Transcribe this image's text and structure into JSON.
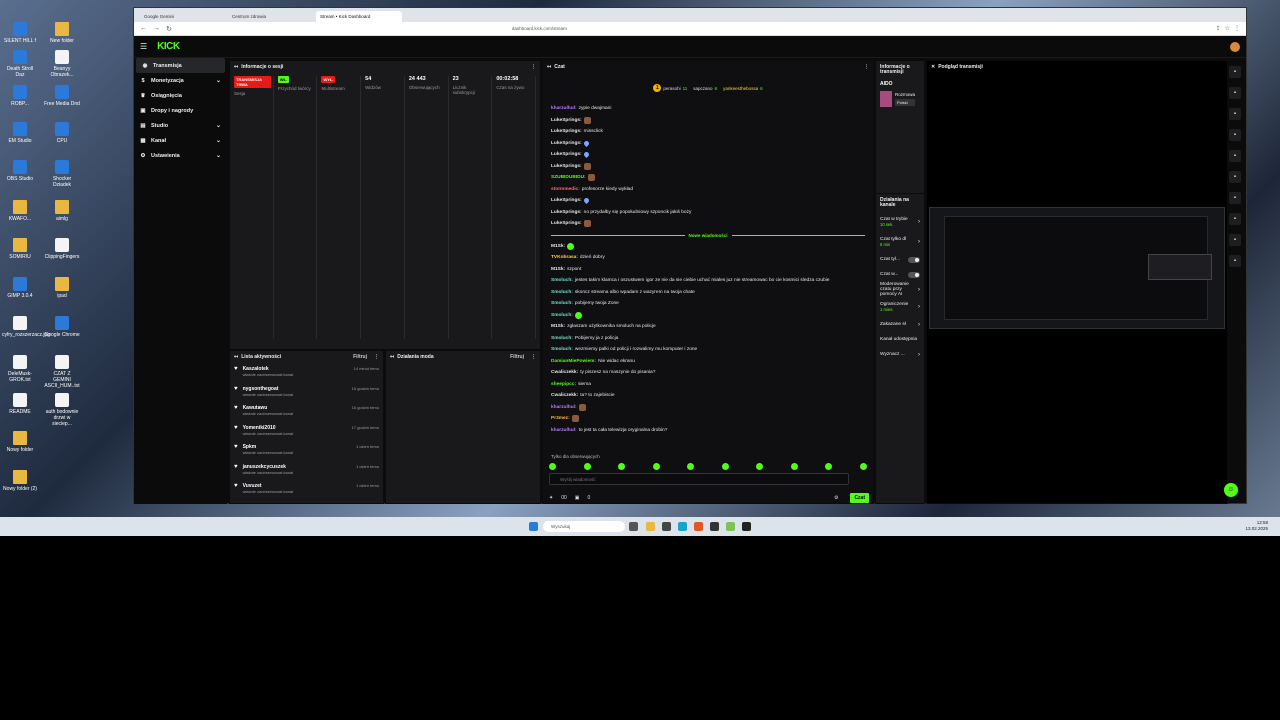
{
  "desktop": {
    "icons": [
      {
        "label": "SILENT HILL f",
        "kind": "app"
      },
      {
        "label": "Death Stroll Daz",
        "kind": "app"
      },
      {
        "label": "ROBP...",
        "kind": "app"
      },
      {
        "label": "EM Studio",
        "kind": "app"
      },
      {
        "label": "OBS Studio",
        "kind": "app"
      },
      {
        "label": "KWAFO...",
        "kind": "fold"
      },
      {
        "label": "SOMIRIU",
        "kind": "fold"
      },
      {
        "label": "GIMP 3.0.4",
        "kind": "app"
      },
      {
        "label": "cyfry_rozszerzacz.jpg",
        "kind": "doc"
      },
      {
        "label": "DeleMusk-GROK.txt",
        "kind": "doc"
      },
      {
        "label": "README",
        "kind": "doc"
      },
      {
        "label": "Nowy folder",
        "kind": "fold"
      },
      {
        "label": "Nowy folder (2)",
        "kind": "fold"
      },
      {
        "label": "New folder",
        "kind": "fold"
      },
      {
        "label": "Beanyy Obrazek...",
        "kind": "doc"
      },
      {
        "label": "Free Media Dnd",
        "kind": "app"
      },
      {
        "label": "CPU",
        "kind": "app"
      },
      {
        "label": "Shocker Dziadek",
        "kind": "app"
      },
      {
        "label": "aimlg",
        "kind": "fold"
      },
      {
        "label": "ClippingFingers",
        "kind": "doc"
      },
      {
        "label": "ipad",
        "kind": "fold"
      },
      {
        "label": "Google Chrome",
        "kind": "app"
      },
      {
        "label": "CZAT Z GEMINI ASCII_HUM..txt",
        "kind": "doc"
      },
      {
        "label": "auth bodownie drzwi w sieciep...",
        "kind": "doc"
      }
    ]
  },
  "browser": {
    "tabs": [
      {
        "label": "Google Gemini"
      },
      {
        "label": "Centrum zdrowia"
      },
      {
        "label": "Stream • Kick Dashboard"
      }
    ],
    "url": "dashboard.kick.com/stream"
  },
  "kick": {
    "logo": "KICK",
    "sidebar": [
      {
        "label": "Transmisja",
        "icon": "broadcast-icon",
        "chev": ""
      },
      {
        "label": "Monetyzacja",
        "icon": "money-icon",
        "chev": "⌄"
      },
      {
        "label": "Osiągnięcia",
        "icon": "trophy-icon",
        "chev": ""
      },
      {
        "label": "Dropy i nagrody",
        "icon": "gift-icon",
        "chev": ""
      },
      {
        "label": "Studio",
        "icon": "studio-icon",
        "chev": "⌄"
      },
      {
        "label": "Kanał",
        "icon": "channel-icon",
        "chev": "⌄"
      },
      {
        "label": "Ustawienia",
        "icon": "gear-icon",
        "chev": "⌄"
      }
    ],
    "session": {
      "title": "Informacje o sesji",
      "stats": [
        {
          "pill": "TRANSMISJA TRWA",
          "pillcolor": "red",
          "value": "",
          "label": "Sesja"
        },
        {
          "pill": "WŁ.",
          "pillcolor": "green",
          "value": "",
          "label": "Przychód twórcy"
        },
        {
          "pill": "WYŁ.",
          "pillcolor": "red",
          "value": "",
          "label": "Multistream"
        },
        {
          "pill": "",
          "pillcolor": "",
          "value": "54",
          "label": "Widzów"
        },
        {
          "pill": "",
          "pillcolor": "",
          "value": "24 443",
          "label": "Obserwujących"
        },
        {
          "pill": "",
          "pillcolor": "",
          "value": "23",
          "label": "Licznik subskrypcji"
        },
        {
          "pill": "",
          "pillcolor": "",
          "value": "00:02:58",
          "label": "Czas na żywo"
        }
      ]
    },
    "activity": {
      "title": "Lista aktywności",
      "filter": "Filtruj",
      "items": [
        {
          "name": "Kaszalotek",
          "sub": "właśnie zaobserwował kanał",
          "time": "14 minut temu"
        },
        {
          "name": "nygsonthegoat",
          "sub": "właśnie zaobserwował kanał",
          "time": "15 godzin temu"
        },
        {
          "name": "Kawutawu",
          "sub": "właśnie zaobserwował kanał",
          "time": "16 godzin temu"
        },
        {
          "name": "Yomeniki2010",
          "sub": "właśnie zaobserwował kanał",
          "time": "17 godzin temu"
        },
        {
          "name": "Spkm",
          "sub": "właśnie zaobserwował kanał",
          "time": "1 dzień temu"
        },
        {
          "name": "januszekcycuszek",
          "sub": "właśnie zaobserwował kanał",
          "time": "1 dzień temu"
        },
        {
          "name": "Vuvuzet",
          "sub": "właśnie zaobserwował kanał",
          "time": "1 dzień temu"
        }
      ]
    },
    "mod": {
      "title": "Działania moda",
      "filter": "Filtruj"
    },
    "chat": {
      "title": "Czat",
      "pinned": [
        {
          "name": "perasohi",
          "count": "11"
        },
        {
          "name": "sapczano",
          "count": "6"
        },
        {
          "name": "yankeesthebossa",
          "count": "6"
        }
      ],
      "messages": [
        {
          "user": "kharzulhul",
          "color": "#b57cff",
          "text": "zypie dwajmani",
          "emote": ""
        },
        {
          "user": "LukeSprings",
          "color": "#e6e6e6",
          "text": "",
          "emote": "img"
        },
        {
          "user": "LukeSprings",
          "color": "#e6e6e6",
          "text": "missclick",
          "emote": ""
        },
        {
          "user": "LukeSprings",
          "color": "#e6e6e6",
          "text": "",
          "emote": "drop"
        },
        {
          "user": "LukeSprings",
          "color": "#e6e6e6",
          "text": "",
          "emote": "drop"
        },
        {
          "user": "LukeSprings",
          "color": "#e6e6e6",
          "text": "",
          "emote": "img"
        },
        {
          "user": "SZUBIDUBIDU",
          "color": "#53fc18",
          "text": "",
          "emote": "img"
        },
        {
          "user": "stormmedic",
          "color": "#ff6b6b",
          "text": "profesorze kiedy wykład",
          "emote": ""
        },
        {
          "user": "LukeSprings",
          "color": "#e6e6e6",
          "text": "",
          "emote": "drop"
        },
        {
          "user": "LukeSprings",
          "color": "#e6e6e6",
          "text": "no przydałby się popołudniowy szponcik jakiś boży",
          "emote": ""
        },
        {
          "user": "LukeSprings",
          "color": "#e6e6e6",
          "text": "",
          "emote": "img"
        }
      ],
      "new_label": "Nowe wiadomości",
      "new_messages": [
        {
          "user": "M1Sk",
          "color": "#e6e6e6",
          "text": "",
          "emote": "kick"
        },
        {
          "user": "TVKobrasa",
          "color": "#ffd24a",
          "text": "dzień dobry",
          "emote": ""
        },
        {
          "user": "M1Sk",
          "color": "#e6e6e6",
          "text": "szpont",
          "emote": ""
        },
        {
          "user": "Smoluch",
          "color": "#6fe3d0",
          "text": "jestes takim klamca i oszustwem igor ze nie da sie ciebie uchać miales juz nie streamowac bo cie kosmici sledza czubie",
          "emote": ""
        },
        {
          "user": "Smoluch",
          "color": "#6fe3d0",
          "text": "skoncz streama albo wpadam z wazyrem na twoja chate",
          "emote": ""
        },
        {
          "user": "Smoluch",
          "color": "#6fe3d0",
          "text": "pobijemy twoja Zone",
          "emote": ""
        },
        {
          "user": "Smoluch",
          "color": "#6fe3d0",
          "text": "",
          "emote": "kick"
        },
        {
          "user": "M1Sk",
          "color": "#e6e6e6",
          "text": "zgłaszam użytkownika smoluch na policje",
          "emote": ""
        },
        {
          "user": "Smoluch",
          "color": "#6fe3d0",
          "text": "Pobijemy ja z policja",
          "emote": ""
        },
        {
          "user": "Smoluch",
          "color": "#6fe3d0",
          "text": "wezmiemy palki od policji i rozwalimy mu komputer i zone",
          "emote": ""
        },
        {
          "user": "DamianMiePowiem",
          "color": "#53fc18",
          "text": "Nie widac ekranu",
          "emote": ""
        },
        {
          "user": "Cwaliczekk",
          "color": "#e6e6e6",
          "text": "ty piszesz na maszynie do pisania?",
          "emote": ""
        },
        {
          "user": "sheepipcc",
          "color": "#53fc18",
          "text": "siema",
          "emote": ""
        },
        {
          "user": "Cwaliczekk",
          "color": "#e6e6e6",
          "text": "ta? to zajebiscie",
          "emote": ""
        },
        {
          "user": "kharzulhul",
          "color": "#b57cff",
          "text": "",
          "emote": "img"
        },
        {
          "user": "Pr3mez",
          "color": "#ffb347",
          "text": "",
          "emote": "img"
        },
        {
          "user": "kharzulhul",
          "color": "#b57cff",
          "text": "to jest ta cała telewizja oryginalna drobin?",
          "emote": ""
        }
      ],
      "followers_only": "Tylko dla obserwujących",
      "input_placeholder": "Wyślij wiadomość",
      "count_a": "00",
      "count_b": "0",
      "send_label": "Czat"
    },
    "channel_info": {
      "title": "Informacje o transmisji",
      "game": "AIDO",
      "sub": "Rozmowa",
      "lang": "Polski"
    },
    "channel_actions": {
      "title": "Działania na kanale",
      "rows": [
        {
          "label": "Czat w trybie",
          "sub": "10 sek.",
          "ctl": "arrow"
        },
        {
          "label": "Czat tylko dl",
          "sub": "6 min",
          "ctl": "arrow"
        },
        {
          "label": "Czat tyl...",
          "sub": "",
          "ctl": "toggle"
        },
        {
          "label": "Czat w...",
          "sub": "",
          "ctl": "toggle"
        },
        {
          "label": "Moderowanie czatu przy pomocy AI",
          "sub": "",
          "ctl": "arrow"
        },
        {
          "label": "Ograniczenie",
          "sub": "1 mies.",
          "ctl": "arrow"
        },
        {
          "label": "Zakazane sł",
          "sub": "",
          "ctl": "arrow"
        },
        {
          "label": "Kanał udostępnia",
          "sub": "",
          "ctl": ""
        },
        {
          "label": "Wyznacz ...",
          "sub": "",
          "ctl": "arrow"
        }
      ]
    },
    "preview": {
      "title": "Podgląd transmisji"
    }
  },
  "taskbar": {
    "search_placeholder": "Wyszukaj",
    "time": "12:58",
    "date": "13.02.2025"
  }
}
